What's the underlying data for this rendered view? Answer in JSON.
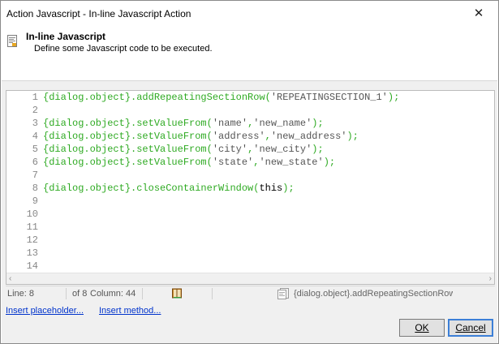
{
  "window": {
    "title": "Action Javascript - In-line Javascript Action",
    "close_glyph": "✕"
  },
  "header": {
    "icon": "script-document-icon",
    "title": "In-line Javascript",
    "subtitle": "Define some Javascript code to be executed."
  },
  "editor": {
    "lines": [
      {
        "n": "1",
        "tokens": [
          {
            "t": "{dialog.object}.addRepeatingSectionRow(",
            "c": "obj"
          },
          {
            "t": "'REPEATINGSECTION_1'",
            "c": "str"
          },
          {
            "t": ");",
            "c": "obj"
          }
        ]
      },
      {
        "n": "2",
        "tokens": []
      },
      {
        "n": "3",
        "tokens": [
          {
            "t": "{dialog.object}.setValueFrom(",
            "c": "obj"
          },
          {
            "t": "'name'",
            "c": "str"
          },
          {
            "t": ",",
            "c": "obj"
          },
          {
            "t": "'new_name'",
            "c": "str"
          },
          {
            "t": ");",
            "c": "obj"
          }
        ]
      },
      {
        "n": "4",
        "tokens": [
          {
            "t": "{dialog.object}.setValueFrom(",
            "c": "obj"
          },
          {
            "t": "'address'",
            "c": "str"
          },
          {
            "t": ",",
            "c": "obj"
          },
          {
            "t": "'new_address'",
            "c": "str"
          },
          {
            "t": ");",
            "c": "obj"
          }
        ]
      },
      {
        "n": "5",
        "tokens": [
          {
            "t": "{dialog.object}.setValueFrom(",
            "c": "obj"
          },
          {
            "t": "'city'",
            "c": "str"
          },
          {
            "t": ",",
            "c": "obj"
          },
          {
            "t": "'new_city'",
            "c": "str"
          },
          {
            "t": ");",
            "c": "obj"
          }
        ]
      },
      {
        "n": "6",
        "tokens": [
          {
            "t": "{dialog.object}.setValueFrom(",
            "c": "obj"
          },
          {
            "t": "'state'",
            "c": "str"
          },
          {
            "t": ",",
            "c": "obj"
          },
          {
            "t": "'new_state'",
            "c": "str"
          },
          {
            "t": ");",
            "c": "obj"
          }
        ]
      },
      {
        "n": "7",
        "tokens": []
      },
      {
        "n": "8",
        "tokens": [
          {
            "t": "{dialog.object}.closeContainerWindow(",
            "c": "obj"
          },
          {
            "t": "this",
            "c": "plain"
          },
          {
            "t": ");",
            "c": "obj"
          }
        ]
      },
      {
        "n": "9",
        "tokens": []
      },
      {
        "n": "10",
        "tokens": []
      },
      {
        "n": "11",
        "tokens": []
      },
      {
        "n": "12",
        "tokens": []
      },
      {
        "n": "13",
        "tokens": []
      },
      {
        "n": "14",
        "tokens": []
      }
    ],
    "colors": {
      "obj": "#2eaa22",
      "str": "#555555",
      "plain": "#000000"
    },
    "scroll_left_glyph": "‹",
    "scroll_right_glyph": "›"
  },
  "status": {
    "line": "Line: 8",
    "of": "of 8",
    "column": "Column: 44",
    "book_icon": "book-icon",
    "function_icon": "function-list-icon",
    "function_text": "{dialog.object}.addRepeatingSectionRow"
  },
  "links": {
    "insert_placeholder": "Insert placeholder...",
    "insert_method": "Insert method..."
  },
  "buttons": {
    "ok_label": "OK",
    "cancel_label": "Cancel"
  }
}
